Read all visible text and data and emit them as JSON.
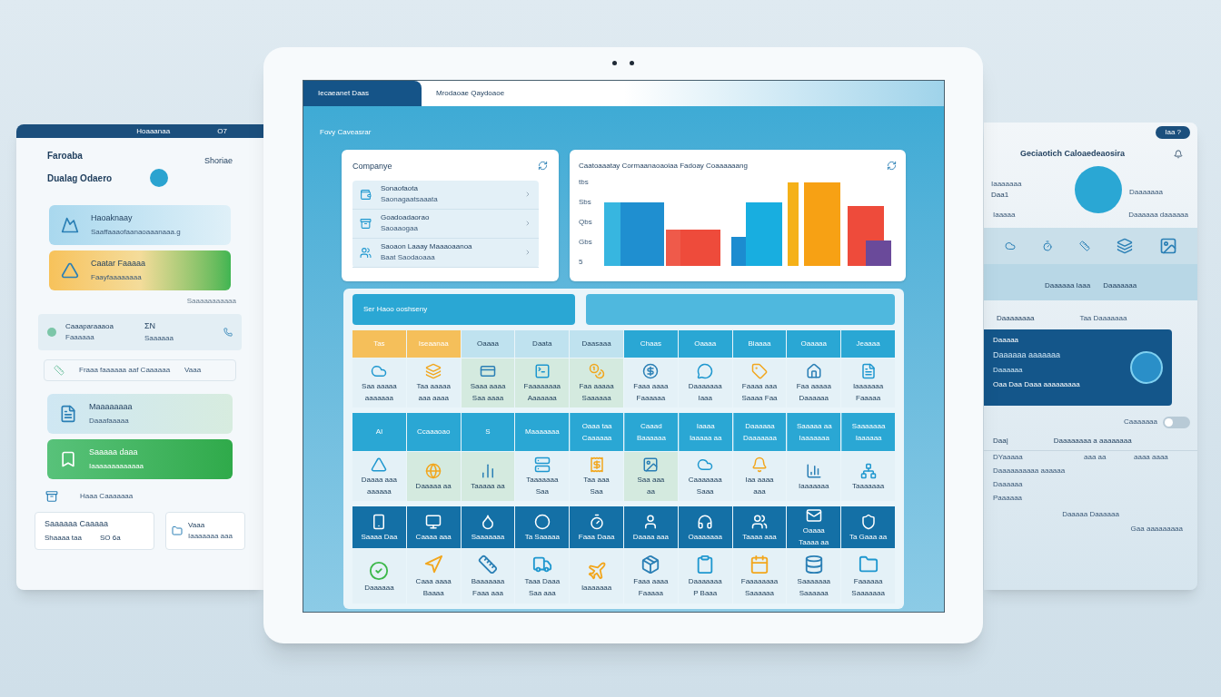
{
  "left_device": {
    "status": {
      "title": "Hoaaanaa",
      "time": "O7"
    },
    "title": "Faroaba",
    "subtitle": "Dualag Odaero",
    "action": "Shoriae",
    "cards": [
      {
        "title": "Haoaknaay",
        "sub": "Saaffaaaofaanaoaaanaaa.g",
        "kind": "blue"
      },
      {
        "title": "Caatar Faaaaa",
        "sub": "Faayfaaaaaaaa",
        "kind": "orange"
      }
    ],
    "note": "Saaaaaaaaaaa",
    "stat": {
      "title": "Caaaparaaaoa",
      "sub": "Faaaaaa",
      "value": "ΣN",
      "value_sub": "Saaaaaa"
    },
    "row": {
      "text": "Fraaa faaaaaa aaf Caaaaaa",
      "value": "Vaaa"
    },
    "cards2": [
      {
        "title": "Maaaaaaaa",
        "sub": "Daaafaaaaa",
        "kind": "light"
      },
      {
        "title": "Saaaaa daaa",
        "sub": "Iaaaaaaaaaaaaa",
        "kind": "green"
      }
    ],
    "link": "Haaa Caaaaaaa",
    "footer": {
      "title": "Saaaaaa Caaaaa",
      "sub": "Shaaaa taa",
      "value": "SO 6a",
      "side_title": "Vaaa",
      "side_sub": "Iaaaaaaa aaa"
    }
  },
  "tablet": {
    "tab": "Iecaeanet Daas",
    "breadcrumb": "Mrodaoae Qaydoaoe",
    "subtitle": "Fovy Caveasrar",
    "company": {
      "title": "Companye",
      "items": [
        {
          "title": "Sonaofaota",
          "sub": "Saonagaatsaaata"
        },
        {
          "title": "Goadoadaorao",
          "sub": "Saoaaogaa"
        },
        {
          "title": "Saoaon Laaay Maaaoaanoa",
          "sub": "Baat Saodaoaaa"
        }
      ]
    },
    "chart": {
      "title": "Caatoaaatay Cormaanaoaoiaa Fadoay Coaaaaaang",
      "y_labels": [
        "tbs",
        "Sbs",
        "Qbs",
        "Gbs",
        "5"
      ]
    },
    "grid": {
      "banner": "Ser Haoo ooshseny",
      "rows": [
        {
          "kind": "header",
          "cells": [
            {
              "lines": [
                "Tas"
              ],
              "kind": "orange"
            },
            {
              "lines": [
                "Iseaanaa"
              ],
              "kind": "orange"
            },
            {
              "lines": [
                "Oaaaa"
              ],
              "kind": "faded"
            },
            {
              "lines": [
                "Daata"
              ],
              "kind": "faded"
            },
            {
              "lines": [
                "Daasaaa"
              ],
              "kind": "faded"
            },
            {
              "lines": [
                "Chaas"
              ],
              "kind": "blue"
            },
            {
              "lines": [
                "Oaaaa"
              ],
              "kind": "blue"
            },
            {
              "lines": [
                "Blaaaa"
              ],
              "kind": "blue"
            },
            {
              "lines": [
                "Oaaaaa"
              ],
              "kind": "blue"
            },
            {
              "lines": [
                "Jeaaaa"
              ],
              "kind": "blue"
            }
          ]
        },
        {
          "kind": "icons",
          "cells": [
            {
              "lines": [
                "Saa aaaaa",
                "aaaaaaa"
              ],
              "kind": "plain"
            },
            {
              "lines": [
                "Taa aaaaa",
                "aaa aaaa"
              ],
              "kind": "plain"
            },
            {
              "lines": [
                "Saaa aaaa",
                "Saa aaaa"
              ],
              "kind": "tint"
            },
            {
              "lines": [
                "Faaaaaaaa",
                "Aaaaaaa"
              ],
              "kind": "tint"
            },
            {
              "lines": [
                "Faa aaaaa",
                "Saaaaaa"
              ],
              "kind": "tint"
            },
            {
              "lines": [
                "Faaa aaaa",
                "Faaaaaa"
              ],
              "kind": "plain"
            },
            {
              "lines": [
                "Daaaaaaa",
                "Iaaa"
              ],
              "kind": "plain"
            },
            {
              "lines": [
                "Faaaa aaa",
                "Saaaa Faa"
              ],
              "kind": "plain"
            },
            {
              "lines": [
                "Faa aaaaa",
                "Daaaaaa"
              ],
              "kind": "plain"
            },
            {
              "lines": [
                "Iaaaaaaa",
                "Faaaaa"
              ],
              "kind": "plain"
            }
          ]
        },
        {
          "kind": "band",
          "cells": [
            {
              "lines": [
                "Al"
              ],
              "kind": "lead"
            },
            {
              "lines": [
                "Ccaaaoao"
              ],
              "kind": "lead"
            },
            {
              "lines": [
                "S"
              ],
              "kind": "lead"
            },
            {
              "lines": [
                "Maaaaaaa"
              ],
              "kind": "lead"
            },
            {
              "lines": [
                "Oaaa taa",
                "Caaaaaa"
              ],
              "kind": "blue"
            },
            {
              "lines": [
                "Caaad",
                "Baaaaaa"
              ],
              "kind": "blue"
            },
            {
              "lines": [
                "Iaaaa",
                "Iaaaaa aa"
              ],
              "kind": "blue"
            },
            {
              "lines": [
                "Daaaaaa",
                "Daaaaaaa"
              ],
              "kind": "blue"
            },
            {
              "lines": [
                "Saaaaa aa",
                "Iaaaaaaa"
              ],
              "kind": "blue"
            },
            {
              "lines": [
                "Saaaaaaa",
                "Iaaaaaa"
              ],
              "kind": "blue"
            }
          ]
        },
        {
          "kind": "icons",
          "cells": [
            {
              "lines": [
                "Daaaa aaa",
                "aaaaaa"
              ],
              "kind": "plain"
            },
            {
              "lines": [
                "Daaaaa aa"
              ],
              "kind": "tint"
            },
            {
              "lines": [
                "Taaaaa aa"
              ],
              "kind": "tint"
            },
            {
              "lines": [
                "Taaaaaaa",
                "Saa"
              ],
              "kind": "plain"
            },
            {
              "lines": [
                "Taa aaa",
                "Saa"
              ],
              "kind": "plain"
            },
            {
              "lines": [
                "Saa aaa",
                "aa"
              ],
              "kind": "tint"
            },
            {
              "lines": [
                "Caaaaaaa",
                "Saaa"
              ],
              "kind": "plain"
            },
            {
              "lines": [
                "Iaa aaaa",
                "aaa"
              ],
              "kind": "plain"
            },
            {
              "lines": [
                "Iaaaaaaa"
              ],
              "kind": "plain"
            },
            {
              "lines": [
                "Taaaaaaa"
              ],
              "kind": "plain"
            }
          ]
        },
        {
          "kind": "dark",
          "cells": [
            {
              "lines": [
                "Saaaa Daa"
              ],
              "kind": "blue"
            },
            {
              "lines": [
                "Caaaa aaa"
              ],
              "kind": "blue"
            },
            {
              "lines": [
                "Saaaaaaa"
              ],
              "kind": "blue"
            },
            {
              "lines": [
                "Ta Saaaaa"
              ],
              "kind": "blue"
            },
            {
              "lines": [
                "Faaa Daaa"
              ],
              "kind": "blue"
            },
            {
              "lines": [
                "Daaaa aaa"
              ],
              "kind": "blue"
            },
            {
              "lines": [
                "Oaaaaaaa"
              ],
              "kind": "blue"
            },
            {
              "lines": [
                "Taaaa aaa"
              ],
              "kind": "blue"
            },
            {
              "lines": [
                "Oaaaa",
                "Taaaa aa"
              ],
              "kind": "blue"
            },
            {
              "lines": [
                "Ta Gaaa aa"
              ],
              "kind": "blue"
            }
          ]
        },
        {
          "kind": "pictures",
          "cells": [
            {
              "lines": [
                "Daaaaaa"
              ],
              "kind": "plain"
            },
            {
              "lines": [
                "Caaa aaaa",
                "Baaaa"
              ],
              "kind": "plain"
            },
            {
              "lines": [
                "Baaaaaaa",
                "Faaa aaa"
              ],
              "kind": "plain"
            },
            {
              "lines": [
                "Taaa Daaa",
                "Saa aaa"
              ],
              "kind": "plain"
            },
            {
              "lines": [
                "Iaaaaaaa"
              ],
              "kind": "plain"
            },
            {
              "lines": [
                "Faaa aaaa",
                "Faaaaa"
              ],
              "kind": "plain"
            },
            {
              "lines": [
                "Daaaaaaa",
                "P Baaa"
              ],
              "kind": "plain"
            },
            {
              "lines": [
                "Faaaaaaaa",
                "Saaaaaa"
              ],
              "kind": "plain"
            },
            {
              "lines": [
                "Saaaaaaa",
                "Saaaaaa"
              ],
              "kind": "plain"
            },
            {
              "lines": [
                "Faaaaaa",
                "Saaaaaaa"
              ],
              "kind": "plain"
            }
          ]
        }
      ]
    }
  },
  "right_device": {
    "top_button": "Iaa ?",
    "title": "Geciaotich Caloaedeaosira",
    "left_stat": {
      "title": "Iaaaaaaa",
      "sub": "Daa1"
    },
    "right_stat": "Daaaaaaa",
    "left_line": "Iaaaaa",
    "right_line": "Daaaaaa daaaaaa",
    "tabs": [
      "Daaaaaa Iaaa",
      "Daaaaaaa"
    ],
    "section": "Daaaaaaaa",
    "section_right": "Taa Daaaaaaa",
    "card": {
      "title": "Daaaaa",
      "sub": "Daaaaaa aaaaaaa",
      "line": "Daaaaaa",
      "footer": "Oaa Daa Daaa aaaaaaaaa"
    },
    "toggle": {
      "label": "Caaaaaaa",
      "on": false
    },
    "table": {
      "columns": [
        "Daa|",
        "Daaaaaaaa a aaaaaaaa"
      ],
      "rows": [
        [
          "DYaaaaa",
          "aaa aa",
          "aaaa aaaa"
        ],
        [
          "Daaaaaaaaaa aaaaaa",
          "",
          ""
        ],
        [
          "Daaaaaa",
          "",
          ""
        ],
        [
          "Paaaaaa",
          "",
          ""
        ]
      ]
    },
    "footer": "Daaaaa Daaaaaa",
    "footer_right": "Gaa aaaaaaaaa"
  }
}
